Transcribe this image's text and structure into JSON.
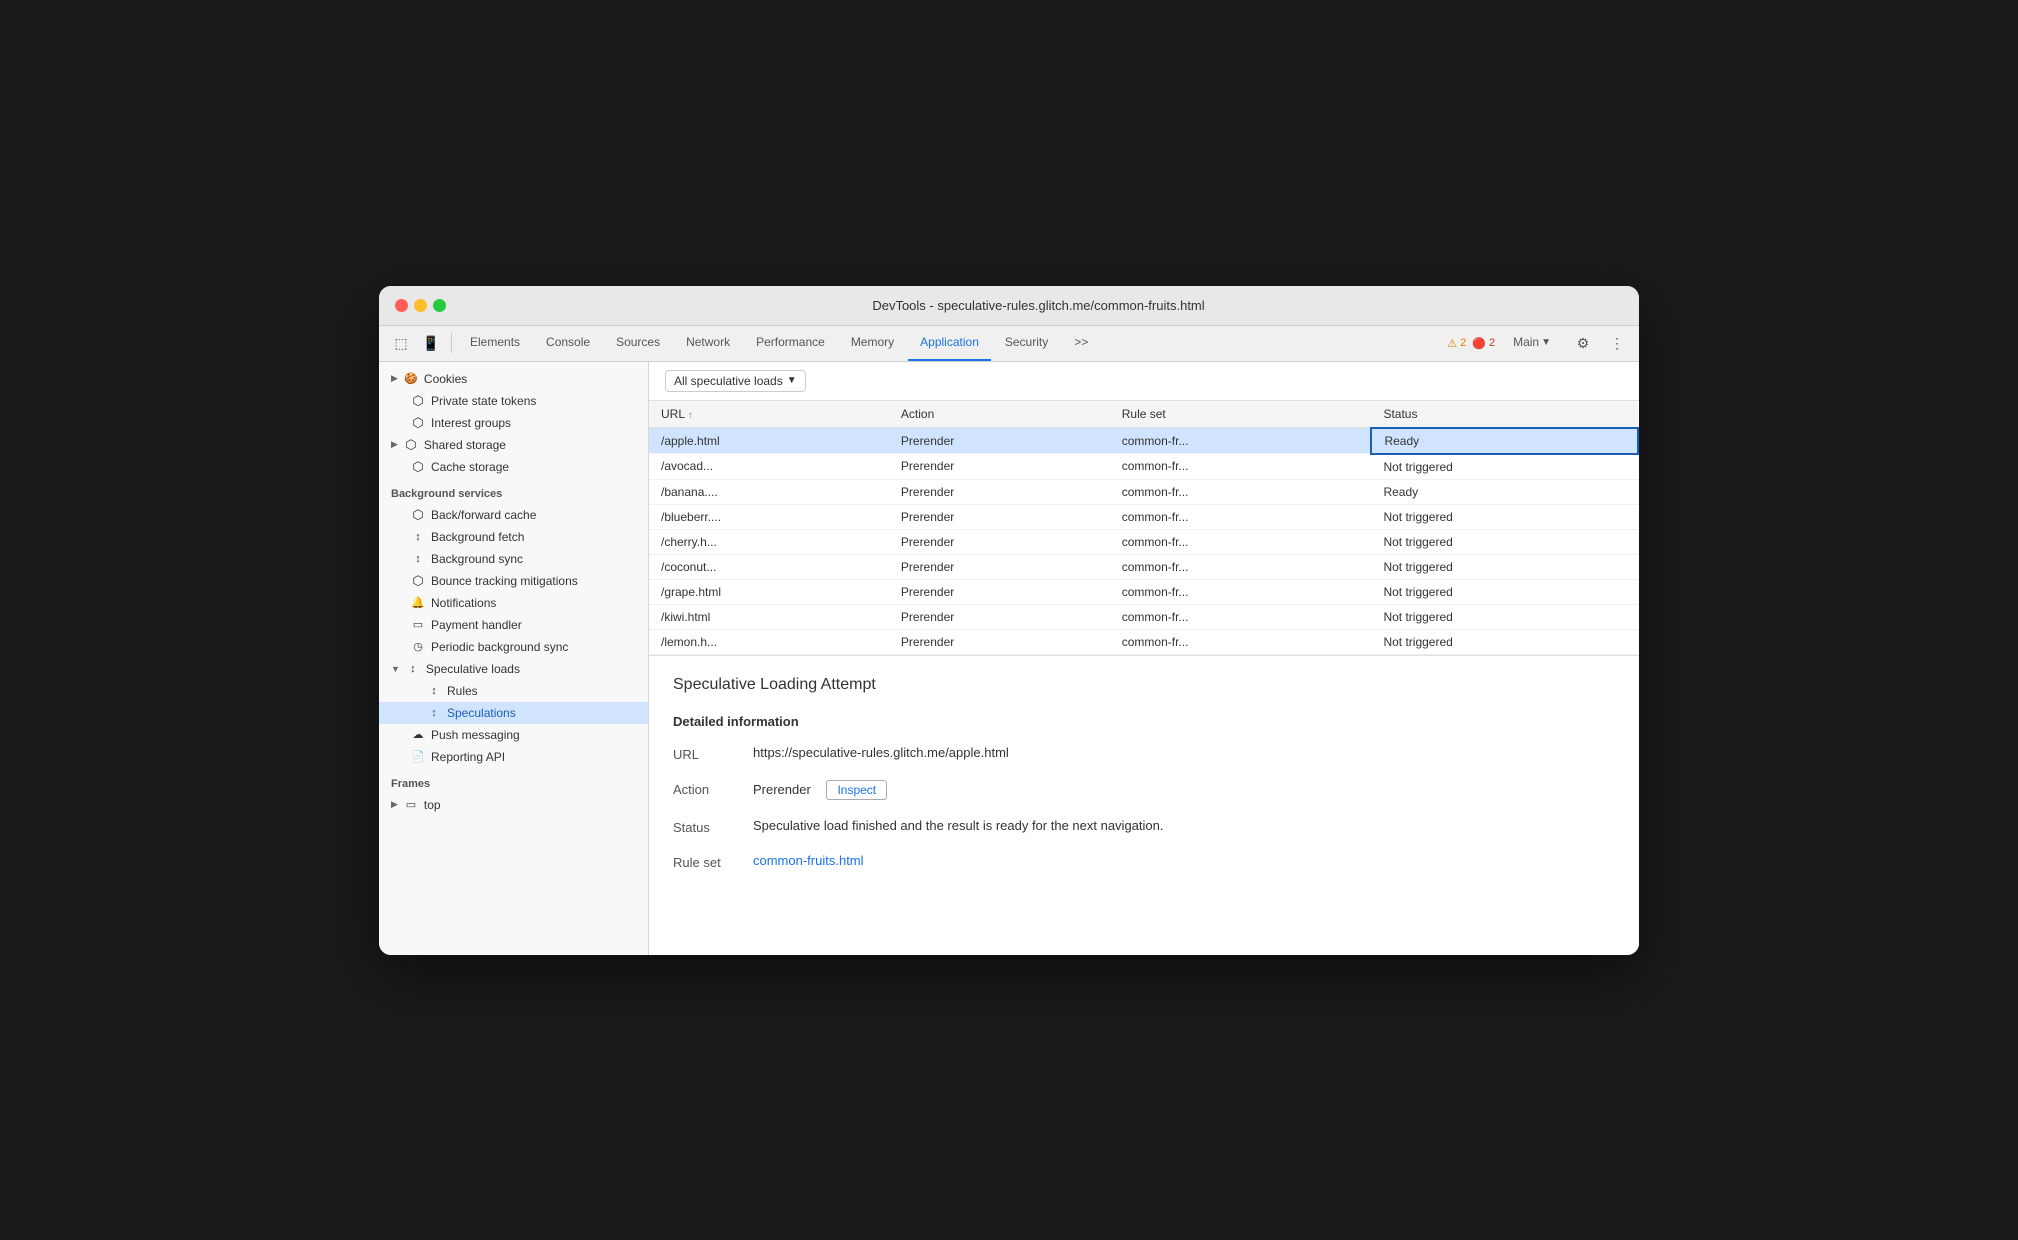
{
  "window": {
    "title": "DevTools - speculative-rules.glitch.me/common-fruits.html"
  },
  "toolbar": {
    "tabs": [
      {
        "label": "Elements",
        "active": false
      },
      {
        "label": "Console",
        "active": false
      },
      {
        "label": "Sources",
        "active": false
      },
      {
        "label": "Network",
        "active": false
      },
      {
        "label": "Performance",
        "active": false
      },
      {
        "label": "Memory",
        "active": false
      },
      {
        "label": "Application",
        "active": true
      },
      {
        "label": "Security",
        "active": false
      }
    ],
    "more_label": ">>",
    "warnings_count": "2",
    "errors_count": "2",
    "main_label": "Main",
    "settings_label": "⚙",
    "more_options_label": "⋮"
  },
  "sidebar": {
    "sections": {
      "storage": {
        "label": "",
        "items": [
          {
            "label": "Cookies",
            "icon": "chevron-expand",
            "indent": 0,
            "expandable": true
          },
          {
            "label": "Private state tokens",
            "icon": "db",
            "indent": 0
          },
          {
            "label": "Interest groups",
            "icon": "db",
            "indent": 0
          },
          {
            "label": "Shared storage",
            "icon": "db",
            "indent": 0,
            "expandable": true
          },
          {
            "label": "Cache storage",
            "icon": "db",
            "indent": 0
          }
        ]
      },
      "background": {
        "label": "Background services",
        "items": [
          {
            "label": "Back/forward cache",
            "icon": "db",
            "indent": 0
          },
          {
            "label": "Background fetch",
            "icon": "sync",
            "indent": 0
          },
          {
            "label": "Background sync",
            "icon": "sync",
            "indent": 0
          },
          {
            "label": "Bounce tracking mitigations",
            "icon": "db",
            "indent": 0
          },
          {
            "label": "Notifications",
            "icon": "bell",
            "indent": 0
          },
          {
            "label": "Payment handler",
            "icon": "card",
            "indent": 0
          },
          {
            "label": "Periodic background sync",
            "icon": "clock",
            "indent": 0
          },
          {
            "label": "Speculative loads",
            "icon": "sync",
            "indent": 0,
            "expandable": true,
            "expanded": true
          },
          {
            "label": "Rules",
            "icon": "sync",
            "indent": 1
          },
          {
            "label": "Speculations",
            "icon": "sync",
            "indent": 1,
            "active": true
          },
          {
            "label": "Push messaging",
            "icon": "cloud",
            "indent": 0
          },
          {
            "label": "Reporting API",
            "icon": "doc",
            "indent": 0
          }
        ]
      },
      "frames": {
        "label": "Frames",
        "items": [
          {
            "label": "top",
            "icon": "frame",
            "indent": 0,
            "expandable": true
          }
        ]
      }
    }
  },
  "content": {
    "filter_label": "All speculative loads",
    "table": {
      "columns": [
        "URL",
        "Action",
        "Rule set",
        "Status"
      ],
      "rows": [
        {
          "url": "/apple.html",
          "action": "Prerender",
          "ruleset": "common-fr...",
          "status": "Ready",
          "selected": true
        },
        {
          "url": "/avocad...",
          "action": "Prerender",
          "ruleset": "common-fr...",
          "status": "Not triggered",
          "selected": false
        },
        {
          "url": "/banana....",
          "action": "Prerender",
          "ruleset": "common-fr...",
          "status": "Ready",
          "selected": false
        },
        {
          "url": "/blueberr....",
          "action": "Prerender",
          "ruleset": "common-fr...",
          "status": "Not triggered",
          "selected": false
        },
        {
          "url": "/cherry.h...",
          "action": "Prerender",
          "ruleset": "common-fr...",
          "status": "Not triggered",
          "selected": false
        },
        {
          "url": "/coconut...",
          "action": "Prerender",
          "ruleset": "common-fr...",
          "status": "Not triggered",
          "selected": false
        },
        {
          "url": "/grape.html",
          "action": "Prerender",
          "ruleset": "common-fr...",
          "status": "Not triggered",
          "selected": false
        },
        {
          "url": "/kiwi.html",
          "action": "Prerender",
          "ruleset": "common-fr...",
          "status": "Not triggered",
          "selected": false
        },
        {
          "url": "/lemon.h...",
          "action": "Prerender",
          "ruleset": "common-fr...",
          "status": "Not triggered",
          "selected": false
        }
      ]
    },
    "detail": {
      "title": "Speculative Loading Attempt",
      "section_title": "Detailed information",
      "url_label": "URL",
      "url_value": "https://speculative-rules.glitch.me/apple.html",
      "action_label": "Action",
      "action_value": "Prerender",
      "inspect_label": "Inspect",
      "status_label": "Status",
      "status_value": "Speculative load finished and the result is ready for the next navigation.",
      "ruleset_label": "Rule set",
      "ruleset_value": "common-fruits.html",
      "ruleset_href": "#"
    }
  },
  "icons": {
    "chevron_right": "▶",
    "chevron_down": "▼",
    "db": "⬡",
    "sync": "↕",
    "bell": "🔔",
    "card": "▭",
    "clock": "◷",
    "cloud": "☁",
    "doc": "📄",
    "frame": "▭",
    "warn": "⚠",
    "err": "🔴",
    "gear": "⚙",
    "more": "⋮",
    "cursor": "⬚",
    "phone": "📱"
  },
  "colors": {
    "active_tab": "#1a73e8",
    "selected_row_bg": "#d0e4ff",
    "selected_row_border": "#1a5eb8",
    "link": "#1a73e8"
  }
}
